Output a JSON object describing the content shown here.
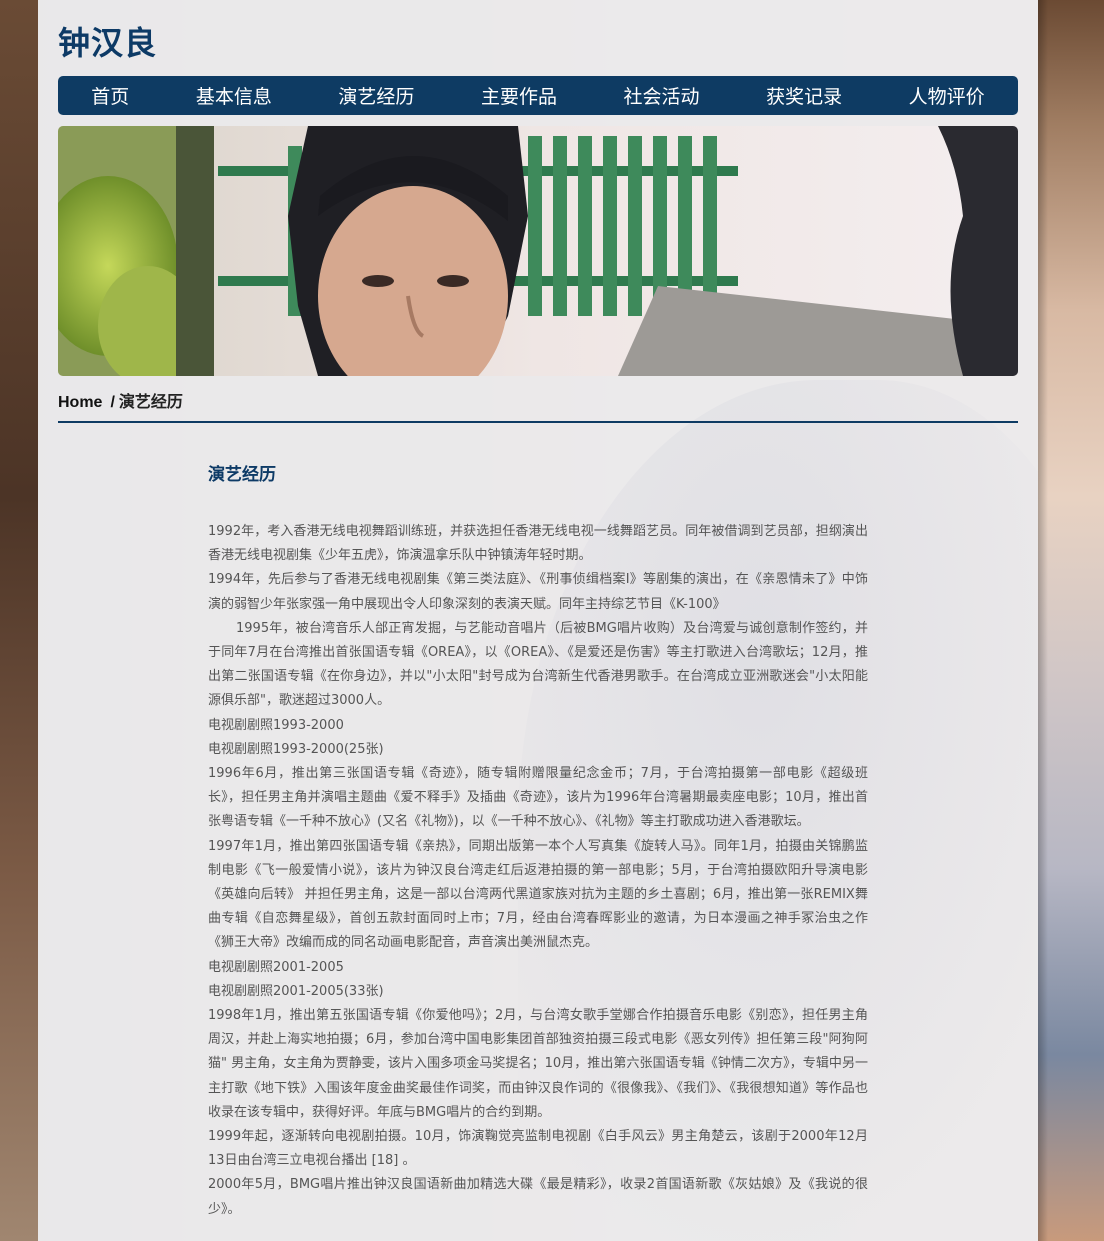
{
  "site": {
    "title": "钟汉良"
  },
  "nav": {
    "items": [
      "首页",
      "基本信息",
      "演艺经历",
      "主要作品",
      "社会活动",
      "获奖记录",
      "人物评价"
    ]
  },
  "breadcrumb": {
    "home": "Home",
    "separator": "/",
    "current": "演艺经历"
  },
  "article": {
    "title": "演艺经历",
    "paragraphs": [
      "1992年，考入香港无线电视舞蹈训练班，并获选担任香港无线电视一线舞蹈艺员。同年被借调到艺员部，担纲演出香港无线电视剧集《少年五虎》，饰演温拿乐队中钟镇涛年轻时期。",
      "1994年，先后参与了香港无线电视剧集《第三类法庭》、《刑事侦缉档案I》等剧集的演出，在《亲恩情未了》中饰演的弱智少年张家强一角中展现出令人印象深刻的表演天赋。同年主持综艺节目《K-100》",
      "1995年，被台湾音乐人邰正宵发掘，与艺能动音唱片（后被BMG唱片收购）及台湾爱与诚创意制作签约，并于同年7月在台湾推出首张国语专辑《OREA》，以《OREA》、《是爱还是伤害》等主打歌进入台湾歌坛；12月，推出第二张国语专辑《在你身边》，并以\"小太阳\"封号成为台湾新生代香港男歌手。在台湾成立亚洲歌迷会\"小太阳能源俱乐部\"，歌迷超过3000人。",
      "电视剧剧照1993-2000",
      "电视剧剧照1993-2000(25张)",
      "1996年6月，推出第三张国语专辑《奇迹》，随专辑附赠限量纪念金币；7月，于台湾拍摄第一部电影《超级班长》，担任男主角并演唱主题曲《爱不释手》及插曲《奇迹》，该片为1996年台湾暑期最卖座电影；10月，推出首张粤语专辑《一千种不放心》(又名《礼物》)，以《一千种不放心》、《礼物》等主打歌成功进入香港歌坛。",
      "1997年1月，推出第四张国语专辑《亲热》，同期出版第一本个人写真集《旋转人马》。同年1月，拍摄由关锦鹏监制电影《飞一般爱情小说》，该片为钟汉良台湾走红后返港拍摄的第一部电影；5月，于台湾拍摄欧阳升导演电影《英雄向后转》 并担任男主角，这是一部以台湾两代黑道家族对抗为主题的乡土喜剧；6月，推出第一张REMIX舞曲专辑《自恋舞星级》，首创五款封面同时上市；7月，经由台湾春晖影业的邀请，为日本漫画之神手冢治虫之作《狮王大帝》改编而成的同名动画电影配音，声音演出美洲鼠杰克。",
      "电视剧剧照2001-2005",
      "电视剧剧照2001-2005(33张)",
      "1998年1月，推出第五张国语专辑《你爱他吗》；2月，与台湾女歌手堂娜合作拍摄音乐电影《别恋》，担任男主角周汉，并赴上海实地拍摄；6月，参加台湾中国电影集团首部独资拍摄三段式电影《恶女列传》担任第三段\"阿狗阿猫\" 男主角，女主角为贾静雯，该片入围多项金马奖提名；10月，推出第六张国语专辑《钟情二次方》，专辑中另一主打歌《地下铁》入围该年度金曲奖最佳作词奖，而由钟汉良作词的《很像我》、《我们》、《我很想知道》等作品也收录在该专辑中，获得好评。年底与BMG唱片的合约到期。",
      "1999年起，逐渐转向电视剧拍摄。10月，饰演鞠觉亮监制电视剧《白手风云》男主角楚云，该剧于2000年12月13日由台湾三立电视台播出 [18] 。",
      "2000年5月，BMG唱片推出钟汉良国语新曲加精选大碟《最是精彩》，收录2首国语新歌《灰姑娘》及《我说的很少》。"
    ]
  },
  "colors": {
    "nav": "#0e3b63",
    "title": "#0d3a66",
    "body_text": "#555555"
  }
}
